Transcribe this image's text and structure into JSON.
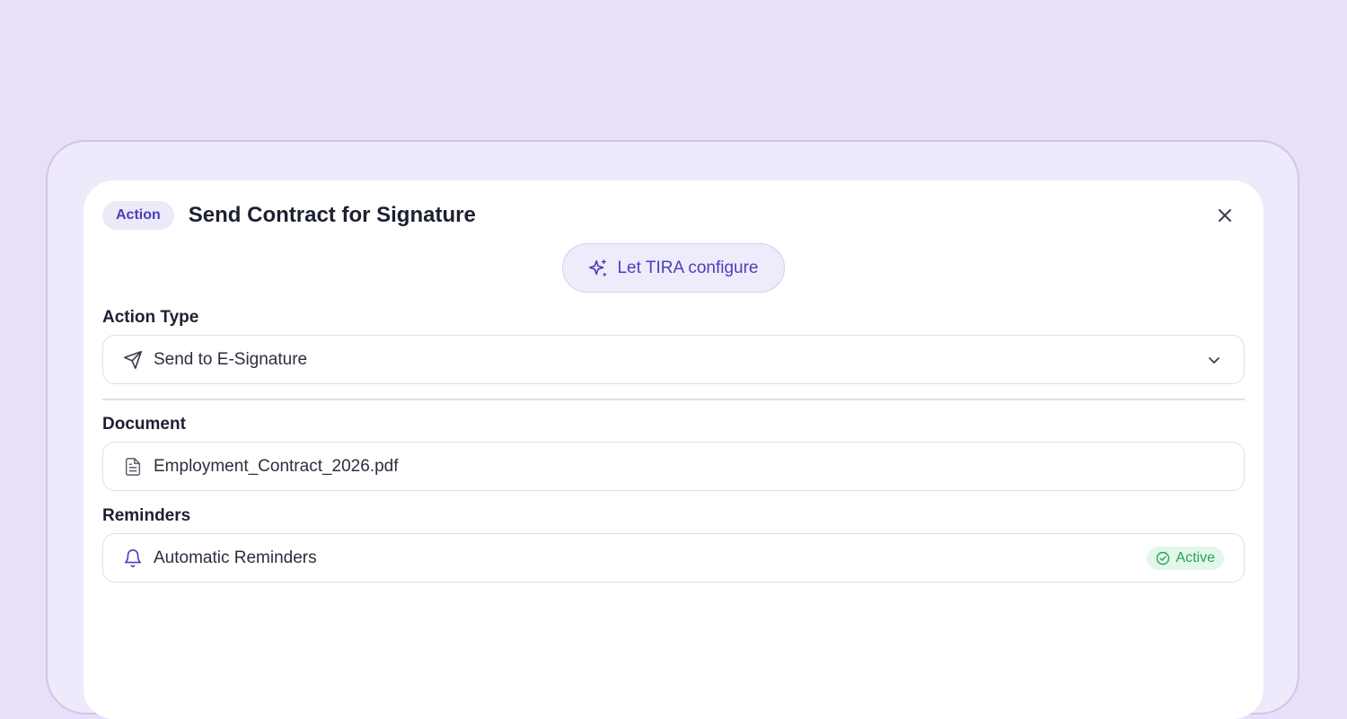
{
  "header": {
    "badge": "Action",
    "title": "Send Contract for Signature"
  },
  "tira_button": {
    "label": "Let TIRA configure",
    "icon": "sparkle-icon"
  },
  "action_type": {
    "label": "Action Type",
    "value": "Send to E-Signature",
    "icon": "send-icon"
  },
  "document": {
    "label": "Document",
    "value": "Employment_Contract_2026.pdf",
    "icon": "file-icon"
  },
  "reminders": {
    "label": "Reminders",
    "value": "Automatic Reminders",
    "icon": "bell-icon",
    "status": "Active",
    "status_color": "#24a55b"
  },
  "colors": {
    "background": "#e8e0fa",
    "accent": "#4a3fb8"
  }
}
